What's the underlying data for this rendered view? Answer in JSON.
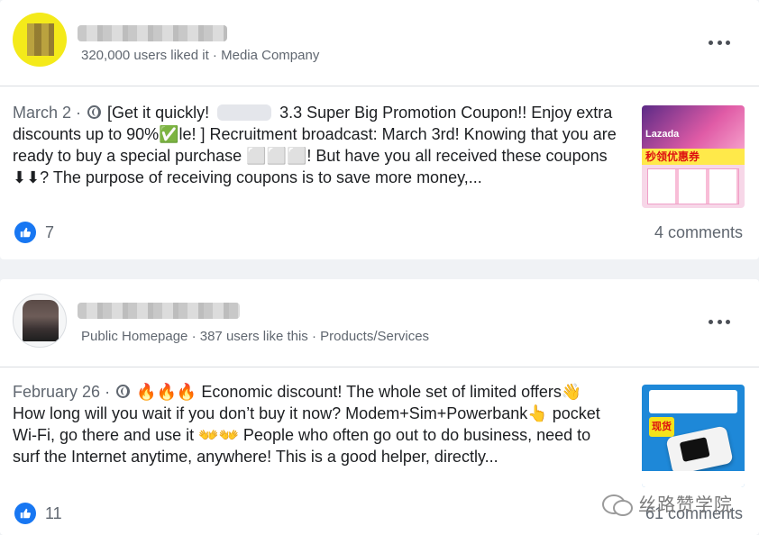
{
  "posts": [
    {
      "page": {
        "likes": "320,000 users liked it",
        "separator": " · ",
        "category": "Media Company"
      },
      "date": "March 2",
      "meta_sep": " · ",
      "text_part1": "[Get it quickly! ",
      "text_part2": " 3.3 Super Big Promotion Coupon!! Enjoy extra discounts up to 90%✅le! ] Recruitment broadcast: March 3rd! Knowing that you are ready to buy a special purchase ⬜⬜⬜! But have you all received these coupons ⬇⬇? The purpose of receiving coupons is to save more money,...",
      "thumbnail": {
        "logo": "Lazada",
        "band": "秒领优惠券"
      },
      "like_count": "7",
      "comments": "4 comments"
    },
    {
      "page": {
        "type": "Public Homepage",
        "separator": " · ",
        "likes": "387 users like this",
        "separator2": " · ",
        "category": "Products/Services"
      },
      "date": "February 26",
      "meta_sep": " · ",
      "text": "🔥🔥🔥 Economic discount! The whole set of limited offers👋 How long will you wait if you don’t buy it now? Modem+Sim+Powerbank👆 pocket Wi-Fi, go there and use it 👐👐 People who often go out to do business, need to surf the Internet anytime, anywhere! This is a good helper, directly...",
      "thumbnail": {
        "tag": "现货"
      },
      "like_count": "11",
      "comments": "61 comments"
    }
  ],
  "watermark": "丝路赞学院",
  "colors": {
    "like_blue": "#1877f2",
    "meta_gray": "#606770",
    "background": "#f0f2f5"
  }
}
